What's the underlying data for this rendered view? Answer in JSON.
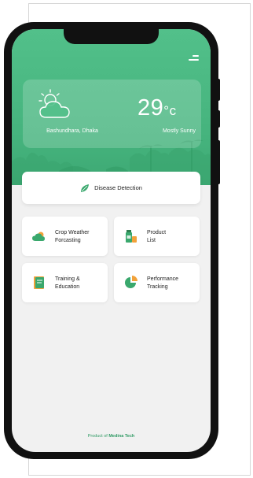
{
  "weather": {
    "location": "Bashundhara, Dhaka",
    "temperature": "29",
    "unit": "°c",
    "condition": "Mostly Sunny",
    "icon": "partly-cloudy-icon"
  },
  "disease_detection": {
    "label": "Disease Detection",
    "icon": "leaf-icon"
  },
  "tiles": [
    {
      "label": "Crop Weather\nForcasting",
      "icon": "cloud-sun-icon"
    },
    {
      "label": "Product\nList",
      "icon": "product-bottle-icon"
    },
    {
      "label": "Training &\nEducation",
      "icon": "book-icon"
    },
    {
      "label": "Performance\nTracking",
      "icon": "pie-chart-icon"
    }
  ],
  "footer": {
    "prefix": "Product of ",
    "brand": "Medina Tech"
  },
  "colors": {
    "primary_green": "#45b37d",
    "accent_orange": "#f2a23a",
    "background": "#f1f1f1"
  }
}
